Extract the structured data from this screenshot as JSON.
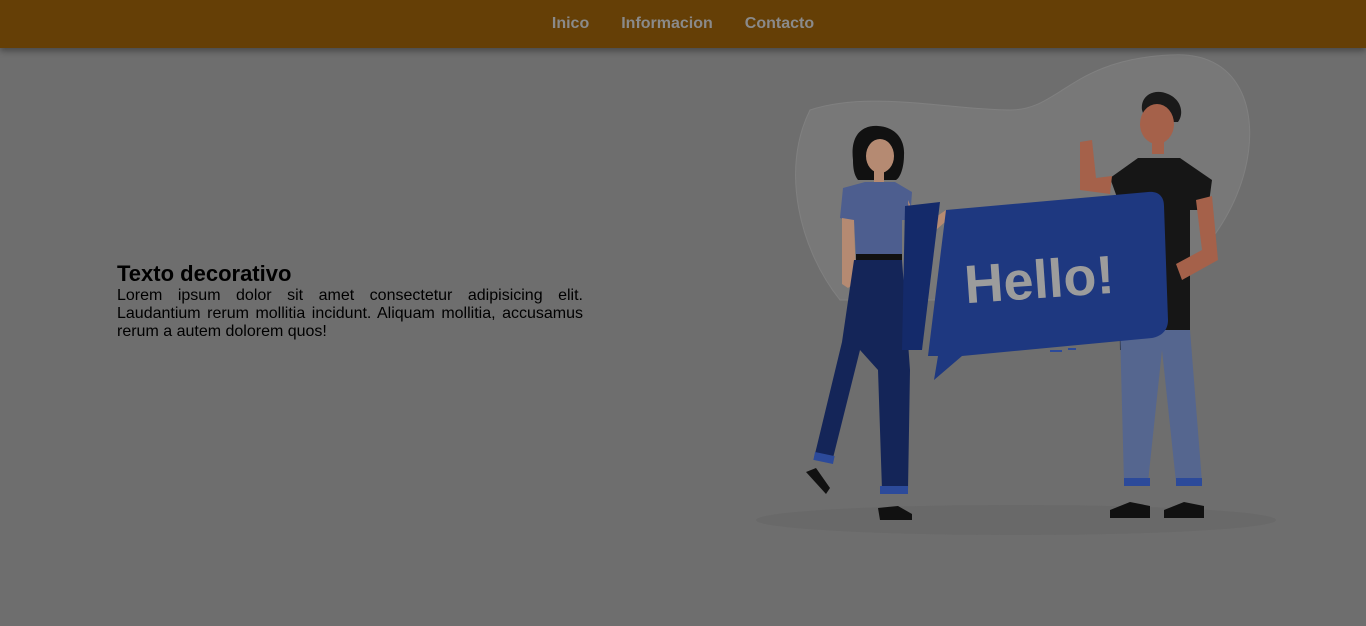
{
  "nav": {
    "items": [
      "Inico",
      "Informacion",
      "Contacto"
    ]
  },
  "hero": {
    "title": "Texto decorativo",
    "body": "Lorem ipsum dolor sit amet consectetur adipisicing elit. Laudantium rerum mollitia incidunt. Aliquam mollitia, accusamus rerum a autem dolorem quos!"
  },
  "illustration": {
    "bubble_text": "Hello!"
  },
  "colors": {
    "navbar": "#653f06",
    "background": "#6e6e6e",
    "bubble": "#1e3880"
  }
}
